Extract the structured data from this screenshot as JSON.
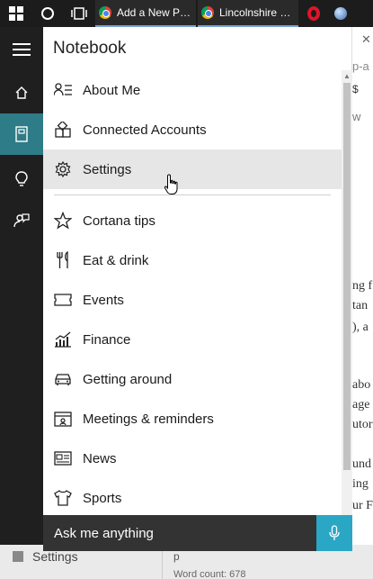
{
  "taskbar": {
    "apps": [
      {
        "label": "Add a New P…",
        "icon": "chrome-icon"
      },
      {
        "label": "Lincolnshire …",
        "icon": "chrome-icon"
      }
    ]
  },
  "notebook": {
    "title": "Notebook",
    "items": [
      {
        "label": "About Me",
        "icon": "about-me-icon"
      },
      {
        "label": "Connected Accounts",
        "icon": "connected-accounts-icon"
      },
      {
        "label": "Settings",
        "icon": "gear-icon"
      },
      {
        "label": "Cortana tips",
        "icon": "star-icon"
      },
      {
        "label": "Eat & drink",
        "icon": "fork-knife-icon"
      },
      {
        "label": "Events",
        "icon": "ticket-icon"
      },
      {
        "label": "Finance",
        "icon": "chart-icon"
      },
      {
        "label": "Getting around",
        "icon": "car-icon"
      },
      {
        "label": "Meetings & reminders",
        "icon": "calendar-icon"
      },
      {
        "label": "News",
        "icon": "newspaper-icon"
      },
      {
        "label": "Sports",
        "icon": "shirt-icon"
      }
    ]
  },
  "askbar": {
    "placeholder": "Ask me anything"
  },
  "background_window": {
    "lines": [
      "p-a",
      "$",
      "w",
      "ng f",
      "tan",
      "), a",
      "abo",
      "age",
      "utor",
      "und",
      "ing",
      "ur F"
    ],
    "settings_label": "Settings",
    "status_p": "p",
    "word_count": "Word count: 678"
  },
  "colors": {
    "accent": "#2e7c87",
    "mic": "#2aa7c4",
    "askbar": "#333333",
    "rail": "#1f1f1f"
  }
}
